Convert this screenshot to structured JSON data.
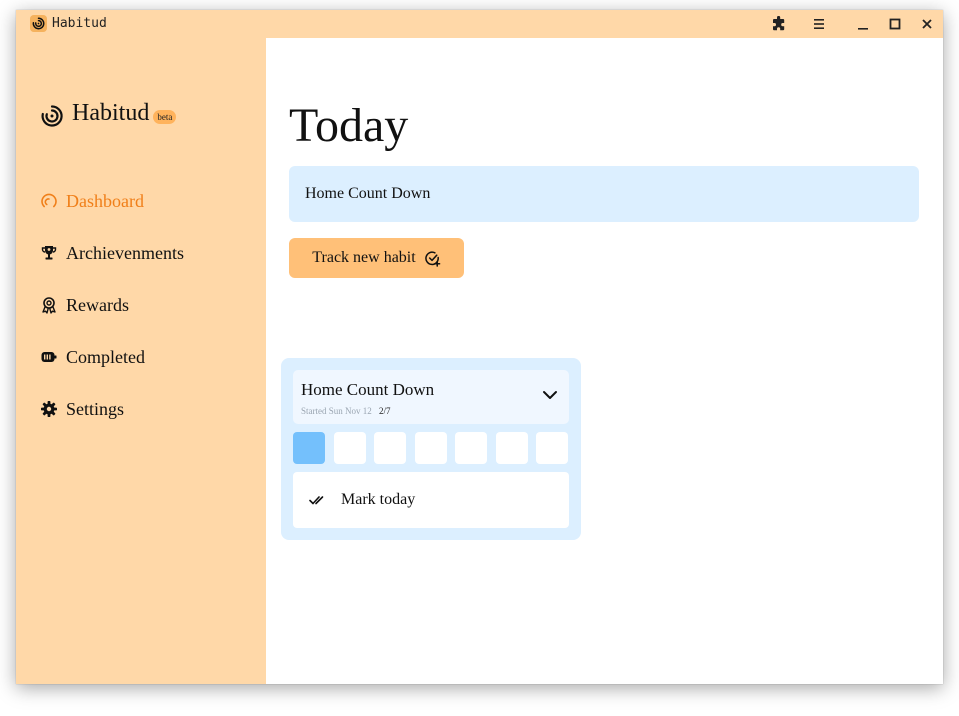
{
  "window": {
    "title": "Habitud",
    "controls": [
      "extensions-icon",
      "menu-icon",
      "minimize-icon",
      "maximize-icon",
      "close-icon"
    ]
  },
  "sidebar": {
    "brand": "Habitud",
    "badge": "beta",
    "items": [
      {
        "label": "Dashboard",
        "icon": "dashboard-icon",
        "active": true
      },
      {
        "label": "Archievenments",
        "icon": "trophy-icon",
        "active": false
      },
      {
        "label": "Rewards",
        "icon": "award-icon",
        "active": false
      },
      {
        "label": "Completed",
        "icon": "completed-icon",
        "active": false
      },
      {
        "label": "Settings",
        "icon": "gear-icon",
        "active": false
      }
    ]
  },
  "main": {
    "title": "Today",
    "habit_select": "Home Count Down",
    "track_button": "Track new habit",
    "card": {
      "title": "Home Count Down",
      "started": "Started Sun Nov 12",
      "progress": "2/7",
      "days_done": [
        true,
        false,
        false,
        false,
        false,
        false,
        false
      ],
      "mark_label": "Mark today"
    }
  },
  "colors": {
    "sidebar_bg": "#ffd8a8",
    "accent": "#f07f19",
    "button_bg": "#ffc078",
    "card_bg": "#dcefff",
    "day_done": "#74c0fc"
  }
}
